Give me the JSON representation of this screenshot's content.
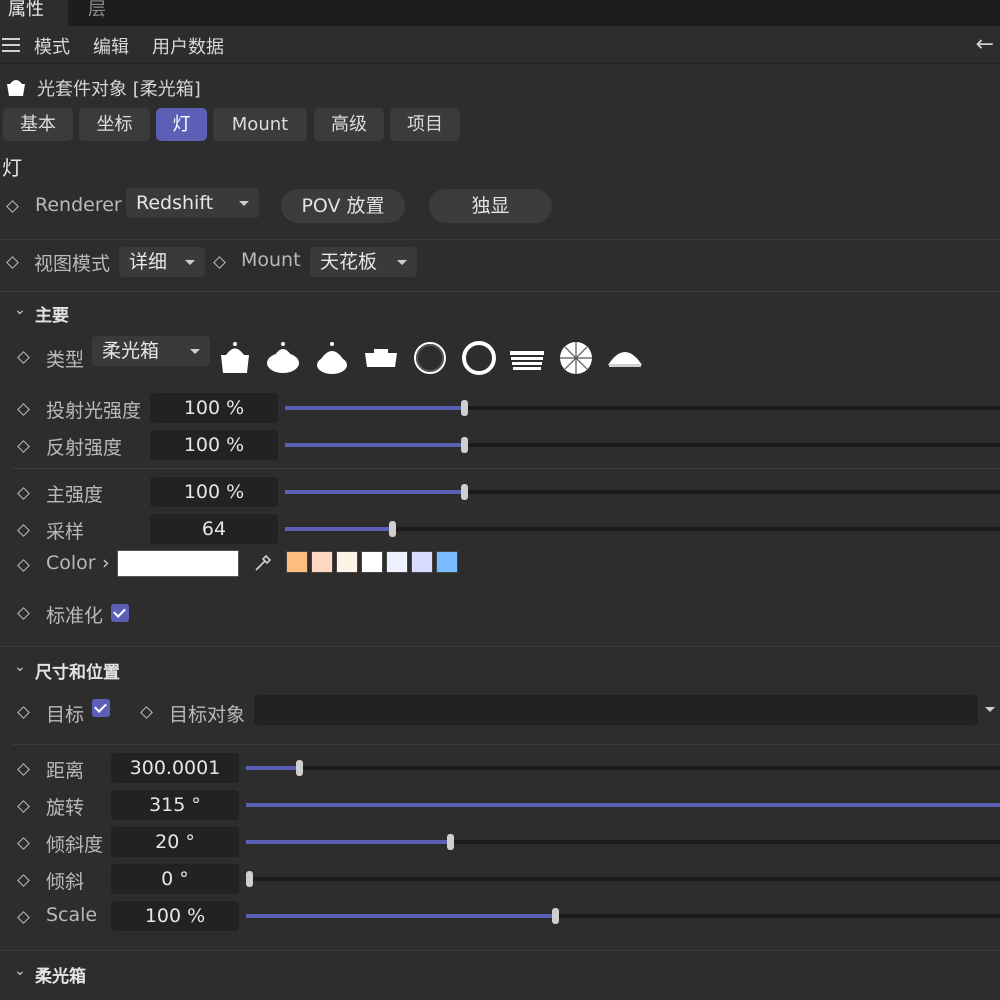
{
  "tabs": [
    {
      "label": "属性"
    },
    {
      "label": "层"
    }
  ],
  "menu": {
    "items": [
      {
        "label": "模式"
      },
      {
        "label": "编辑"
      },
      {
        "label": "用户数据"
      }
    ]
  },
  "object": {
    "title": "光套件对象 [柔光箱]"
  },
  "page_tabs": [
    {
      "label": "基本"
    },
    {
      "label": "坐标"
    },
    {
      "label": "灯",
      "active": true
    },
    {
      "label": "Mount"
    },
    {
      "label": "高级"
    },
    {
      "label": "项目"
    }
  ],
  "section_title": "灯",
  "renderer": {
    "label": "Renderer",
    "value": "Redshift",
    "pov_button": "POV 放置",
    "solo_button": "独显"
  },
  "view": {
    "label": "视图模式",
    "value": "详细",
    "mount_label": "Mount",
    "mount_value": "天花板"
  },
  "main_group": {
    "title": "主要",
    "type_label": "类型",
    "type_value": "柔光箱",
    "light_icons": [
      "softbox-icon",
      "dome-light-icon",
      "spotlight-icon",
      "panel-light-icon",
      "ring-light-icon",
      "ring-light-thick-icon",
      "strip-light-icon",
      "umbrella-icon",
      "half-dome-icon"
    ],
    "params": [
      {
        "label": "投射光强度",
        "value": "100 %",
        "level": 0.25
      },
      {
        "label": "反射强度",
        "value": "100 %",
        "level": 0.25
      },
      {
        "label": "主强度",
        "value": "100 %",
        "level": 0.25
      },
      {
        "label": "采样",
        "value": "64",
        "level": 0.15
      }
    ],
    "color_label": "Color",
    "color_value": "#ffffff",
    "presets": [
      "#ffbc80",
      "#ffd8c2",
      "#fff3e8",
      "#ffffff",
      "#eef0ff",
      "#d6dcff",
      "#78bbff"
    ],
    "normalize_label": "标准化",
    "normalize_checked": true
  },
  "size_group": {
    "title": "尺寸和位置",
    "target_label": "目标",
    "target_checked": true,
    "target_object_label": "目标对象",
    "target_object_value": "",
    "params": [
      {
        "label": "距离",
        "value": "300.0001",
        "level": 0.07
      },
      {
        "label": "旋转",
        "value": "315 °",
        "level": 1.0
      },
      {
        "label": "倾斜度",
        "value": "20 °",
        "level": 0.27
      },
      {
        "label": "倾斜",
        "value": "0 °",
        "level": 0.0
      },
      {
        "label": "Scale",
        "value": "100 %",
        "level": 0.41
      }
    ]
  },
  "softbox_group": {
    "title": "柔光箱"
  },
  "colors": {
    "accent": "#5b5fb5",
    "background": "#2d2d2d"
  }
}
